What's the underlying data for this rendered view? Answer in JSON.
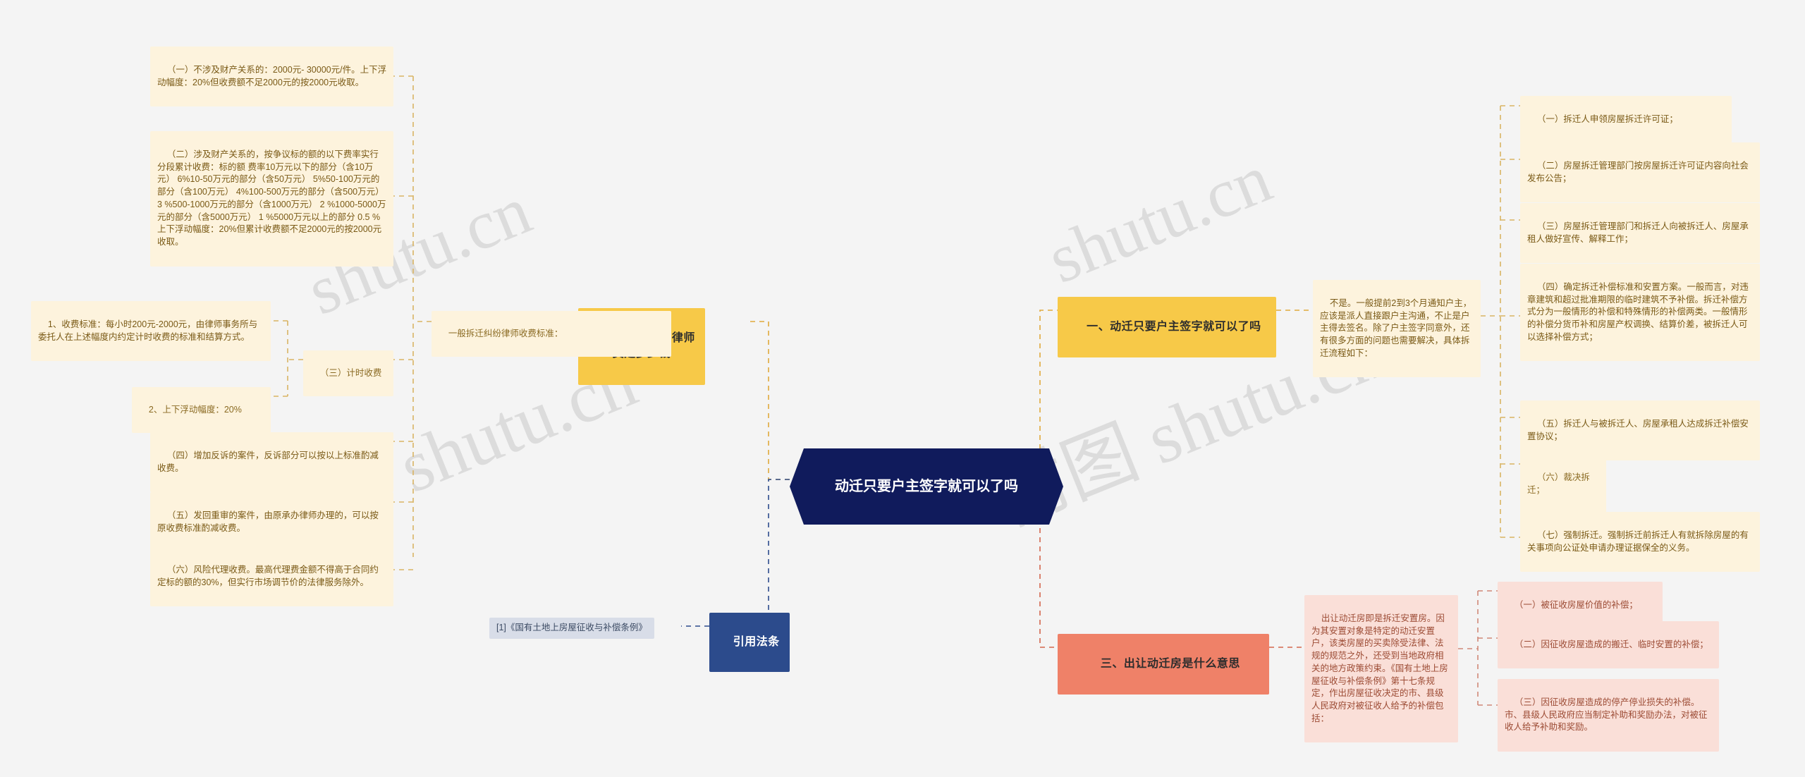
{
  "meta": {
    "bg_color": "#f4f4f4",
    "root_color": "#101b5c",
    "amber_color": "#f7c948",
    "salmon_color": "#ef8168",
    "navy_color": "#2c4b8c",
    "cream_color": "#fdf3dd",
    "pink_color": "#fadfd8"
  },
  "watermark": {
    "text_latin": "shutu.cn",
    "text_cn": "树图 shutu.cn",
    "a": "shutu.cn",
    "b": "shutu.cn",
    "c": "树图 shutu.cn",
    "d": "树图 shutu.cn"
  },
  "root": {
    "label": "动迁只要户主签字就可以了吗"
  },
  "branches": [
    {
      "id": "branch-1",
      "label": "一、动迁只要户主签字就可以了吗",
      "style": "amber",
      "side": "right",
      "summary": "不是。一般提前2到3个月通知户主，应该是派人直接跟户主沟通，不止是户主得去签名。除了户主签字同意外，还有很多方面的问题也需要解决，具体拆迁流程如下：",
      "items": [
        "（一）拆迁人申领房屋拆迁许可证；",
        "（二）房屋拆迁管理部门按房屋拆迁许可证内容向社会发布公告；",
        "（三）房屋拆迁管理部门和拆迁人向被拆迁人、房屋承租人做好宣传、解释工作；",
        "（四）确定拆迁补偿标准和安置方案。一般而言，对违章建筑和超过批准期限的临时建筑不予补偿。拆迁补偿方式分为一般情形的补偿和特殊情形的补偿两类。一般情形的补偿分货币补和房屋产权调换、结算价差，被拆迁人可以选择补偿方式；",
        "（五）拆迁人与被拆迁人、房屋承租人达成拆迁补偿安置协议；",
        "（六）裁决拆迁；",
        "（七）强制拆迁。强制拆迁前拆迁人有就拆除房屋的有关事项向公证处申请办理证据保全的义务。"
      ]
    },
    {
      "id": "branch-2",
      "label": "二、拆迁官司律师费是多少钱",
      "style": "amber",
      "side": "left",
      "summary": "一般拆迁纠纷律师收费标准：",
      "items": [
        "（一）不涉及财产关系的：2000元- 30000元/件。上下浮动幅度：20%但收费额不足2000元的按2000元收取。",
        "（二）涉及财产关系的，按争议标的额的以下费率实行分段累计收费：标的额 费率10万元以下的部分（含10万元） 6%10-50万元的部分（含50万元） 5%50-100万元的部分（含100万元） 4%100-500万元的部分（含500万元） 3 %500-1000万元的部分（含1000万元） 2 %1000-5000万元的部分（含5000万元） 1 %5000万元以上的部分 0.5 %上下浮动幅度：20%但累计收费额不足2000元的按2000元收取。",
        "（三）计时收费",
        "（四）增加反诉的案件，反诉部分可以按以上标准酌减收费。",
        "（五）发回重审的案件，由原承办律师办理的，可以按原收费标准酌减收费。",
        "（六）风险代理收费。最高代理费金额不得高于合同约定标的额的30%，但实行市场调节价的法律服务除外。"
      ],
      "sub_items": [
        "1、收费标准：每小时200元-2000元，由律师事务所与委托人在上述幅度内约定计时收费的标准和结算方式。",
        "2、上下浮动幅度：20%"
      ]
    },
    {
      "id": "branch-3",
      "label": "三、出让动迁房是什么意思",
      "style": "salmon",
      "side": "right",
      "summary": "出让动迁房即是拆迁安置房。因为其安置对象是特定的动迁安置户，该类房屋的买卖除受法律、法规的规范之外，还受到当地政府相关的地方政策约束。《国有土地上房屋征收与补偿条例》第十七条规定，作出房屋征收决定的市、县级人民政府对被征收人给予的补偿包括：",
      "items": [
        "（一）被征收房屋价值的补偿；",
        "（二）因征收房屋造成的搬迁、临时安置的补偿；",
        "（三）因征收房屋造成的停产停业损失的补偿。市、县级人民政府应当制定补助和奖励办法，对被征收人给予补助和奖励。"
      ]
    },
    {
      "id": "branch-4",
      "label": "引用法条",
      "style": "navy",
      "side": "left",
      "items": [
        "[1]《国有土地上房屋征收与补偿条例》"
      ]
    }
  ]
}
